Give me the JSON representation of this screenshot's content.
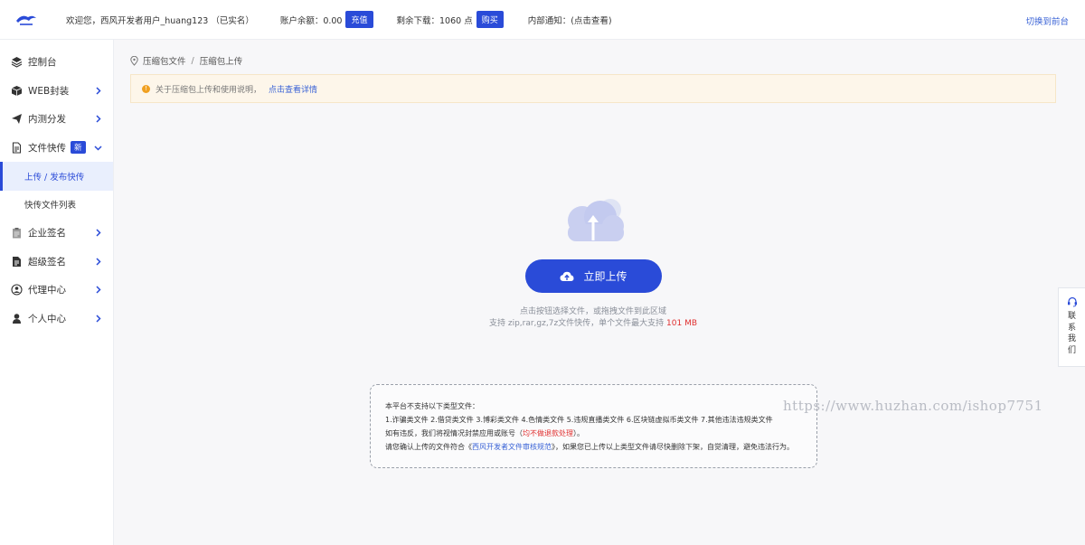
{
  "header": {
    "welcome": "欢迎您，西风开发者用户_huang123 （已实名）",
    "balance_label": "账户余额：0.00",
    "recharge_btn": "充值",
    "downloads_label": "剩余下载：1060 点",
    "buy_btn": "购买",
    "notice": "内部通知：(点击查看)",
    "switch_link": "切换到前台"
  },
  "sidebar": {
    "items": [
      {
        "label": "控制台",
        "icon": "layers-icon"
      },
      {
        "label": "WEB封装",
        "icon": "box-icon"
      },
      {
        "label": "内测分发",
        "icon": "paper-plane-icon"
      },
      {
        "label": "文件快传",
        "icon": "file-icon",
        "badge": "新"
      },
      {
        "label": "企业签名",
        "icon": "clipboard-icon"
      },
      {
        "label": "超级签名",
        "icon": "document-icon"
      },
      {
        "label": "代理中心",
        "icon": "agent-icon"
      },
      {
        "label": "个人中心",
        "icon": "user-icon"
      }
    ],
    "sub_items": [
      {
        "label": "上传 / 发布快传"
      },
      {
        "label": "快传文件列表"
      }
    ]
  },
  "breadcrumb": {
    "root": "压缩包文件",
    "sep": "/",
    "current": "压缩包上传"
  },
  "notice": {
    "text": "关于压缩包上传和使用说明，",
    "link": "点击查看详情"
  },
  "upload": {
    "button": "立即上传",
    "hint1": "点击按钮选择文件，或拖拽文件到此区域",
    "hint2_prefix": "支持 zip,rar,gz,7z文件快传，单个文件最大支持 ",
    "hint2_size": "101 MB"
  },
  "rules": {
    "line1": "本平台不支持以下类型文件：",
    "line2": "1.诈骗类文件 2.借贷类文件 3.博彩类文件 4.色情类文件 5.违规直播类文件 6.区块链虚拟币类文件 7.其他违法违规类文件",
    "line3_prefix": "如有违反，我们将视情况封禁应用或账号（",
    "line3_red": "均不做退款处理",
    "line3_suffix": "）。",
    "line4_prefix": "请您确认上传的文件符合《",
    "line4_link": "西风开发者文件审核规范",
    "line4_suffix": "》，如果您已上传以上类型文件请尽快删除下架，自觉清理，避免违法行为。"
  },
  "watermark": "https://www.huzhan.com/ishop7751",
  "contact": {
    "chars": [
      "联",
      "系",
      "我",
      "们"
    ]
  },
  "colors": {
    "primary": "#2a4bd8",
    "danger": "#e03030",
    "link": "#3a63d6",
    "notice_bg": "#fdf6ea"
  }
}
